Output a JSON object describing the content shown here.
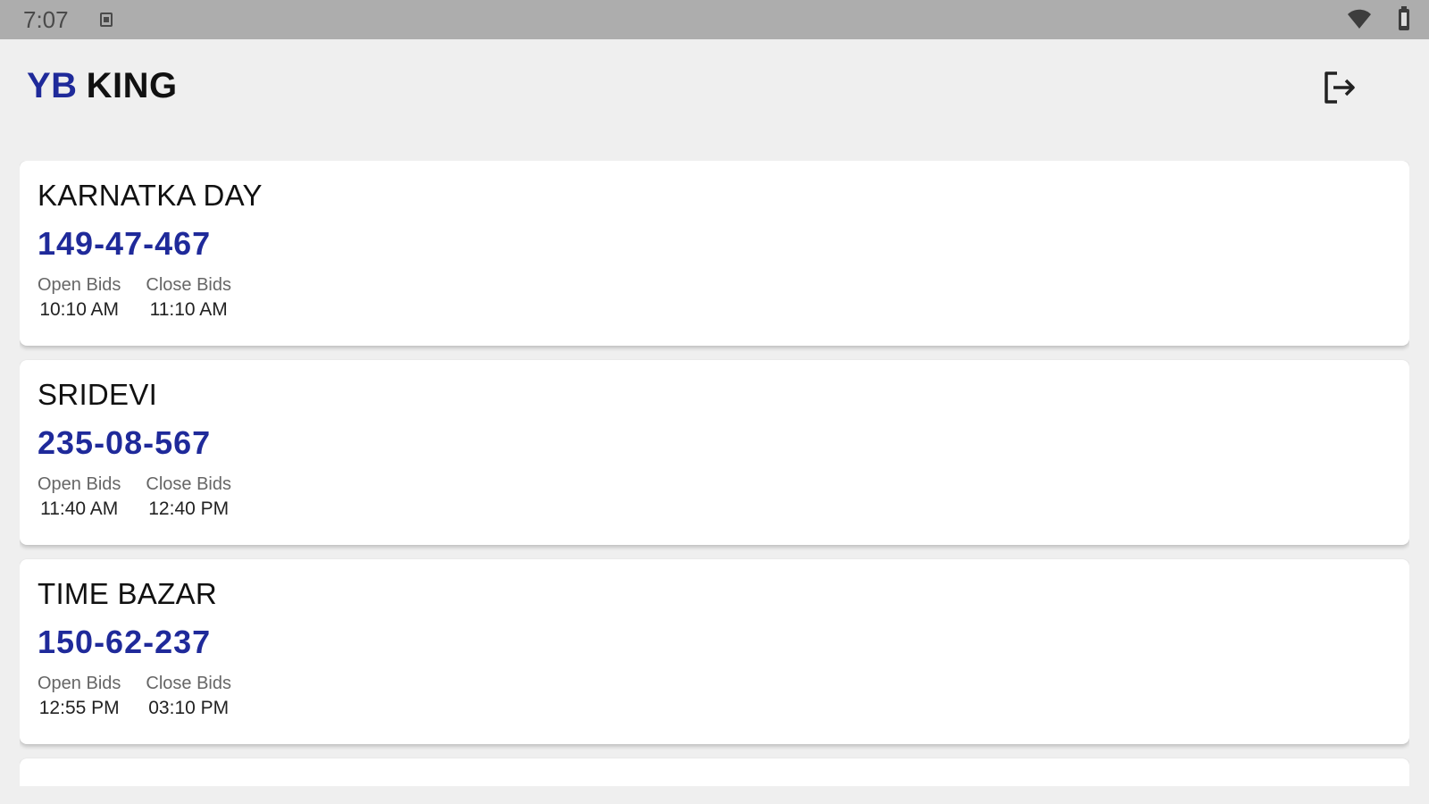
{
  "status_bar": {
    "time": "7:07",
    "icons": [
      "notification-icon",
      "wifi-icon",
      "battery-icon"
    ]
  },
  "header": {
    "brand_part1": "YB",
    "brand_part2": "KING",
    "logout_icon": "logout-icon"
  },
  "colors": {
    "accent": "#1f2a9a",
    "background": "#efefef",
    "status_bar": "#adadad"
  },
  "games": [
    {
      "name": "KARNATKA DAY",
      "result": "149-47-467",
      "open_label": "Open Bids",
      "open_time": "10:10 AM",
      "close_label": "Close Bids",
      "close_time": "11:10 AM"
    },
    {
      "name": "SRIDEVI",
      "result": "235-08-567",
      "open_label": "Open Bids",
      "open_time": "11:40 AM",
      "close_label": "Close Bids",
      "close_time": "12:40 PM"
    },
    {
      "name": "TIME BAZAR",
      "result": "150-62-237",
      "open_label": "Open Bids",
      "open_time": "12:55 PM",
      "close_label": "Close Bids",
      "close_time": "03:10 PM"
    }
  ]
}
